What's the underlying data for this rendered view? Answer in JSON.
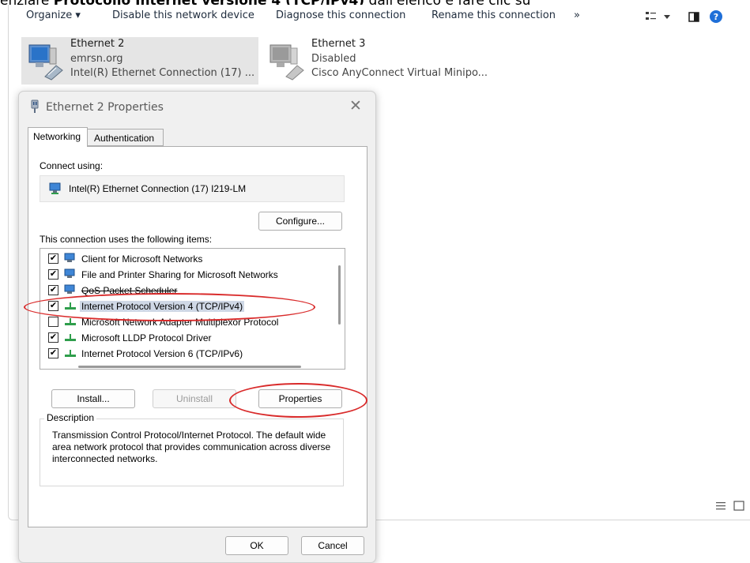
{
  "caption": {
    "pre": "enziare ",
    "bold": "Protocollo Internet versione 4 (TCP/IPv4)",
    "post": " dall'elenco e fare clic su"
  },
  "commandbar": {
    "organize": "Organize ▾",
    "disable": "Disable this network device",
    "diagnose": "Diagnose this connection",
    "rename": "Rename this connection",
    "more": "»"
  },
  "connections": [
    {
      "name": "Ethernet 2",
      "status": "emrsn.org",
      "device": "Intel(R) Ethernet Connection (17) ..."
    },
    {
      "name": "Ethernet 3",
      "status": "Disabled",
      "device": "Cisco AnyConnect Virtual Minipo..."
    }
  ],
  "dialog": {
    "title": "Ethernet 2 Properties",
    "tabs": [
      "Networking",
      "Authentication"
    ],
    "connect_using_label": "Connect using:",
    "adapter": "Intel(R) Ethernet Connection (17) I219-LM",
    "configure_button": "Configure...",
    "items_label": "This connection uses the following items:",
    "items": [
      {
        "label": "Client for Microsoft Networks",
        "checked": true
      },
      {
        "label": "File and Printer Sharing for Microsoft Networks",
        "checked": true
      },
      {
        "label": "QoS Packet Scheduler",
        "checked": true
      },
      {
        "label": "Internet Protocol Version 4 (TCP/IPv4)",
        "checked": true,
        "selected": true
      },
      {
        "label": "Microsoft Network Adapter Multiplexor Protocol",
        "checked": false
      },
      {
        "label": "Microsoft LLDP Protocol Driver",
        "checked": true
      },
      {
        "label": "Internet Protocol Version 6 (TCP/IPv6)",
        "checked": true
      }
    ],
    "install_button": "Install...",
    "uninstall_button": "Uninstall",
    "properties_button": "Properties",
    "description_label": "Description",
    "description_text": "Transmission Control Protocol/Internet Protocol. The default wide area network protocol that provides communication across diverse interconnected networks.",
    "ok_button": "OK",
    "cancel_button": "Cancel"
  },
  "colors": {
    "highlight_oval": "#d92b2b",
    "selection": "#cfd8e6"
  }
}
